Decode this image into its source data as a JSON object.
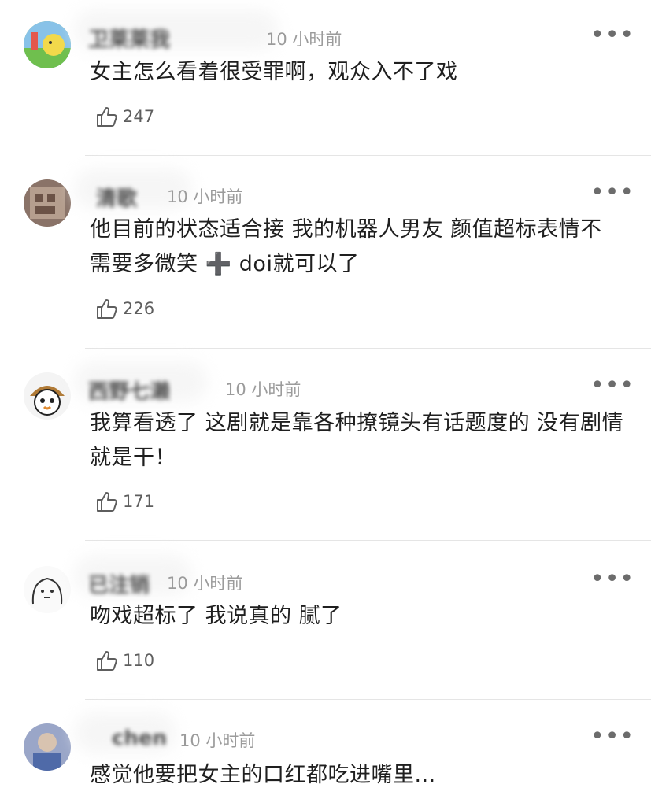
{
  "comments": [
    {
      "username": "卫莱莱我",
      "time": "10 小时前",
      "text": "女主怎么看着很受罪啊，观众入不了戏",
      "likes": "247",
      "more": "•••"
    },
    {
      "username": "清歌",
      "time": "10 小时前",
      "text": "他目前的状态适合接 我的机器人男友 颜值超标表情不需要多微笑 ➕ doi就可以了",
      "likes": "226",
      "more": "•••"
    },
    {
      "username": "西野七濑",
      "time": "10 小时前",
      "text": "我算看透了 这剧就是靠各种撩镜头有话题度的 没有剧情就是干！",
      "likes": "171",
      "more": "•••"
    },
    {
      "username": "已注销",
      "time": "10 小时前",
      "text": "吻戏超标了 我说真的 腻了",
      "likes": "110",
      "more": "•••"
    },
    {
      "username": "chen",
      "time": "10 小时前",
      "text": "感觉他要把女主的口红都吃进嘴里...",
      "likes": "",
      "more": "•••"
    }
  ],
  "colors": {
    "time": "#9b9b9b",
    "divider": "#e5e5e5",
    "like": "#5e5e5e"
  }
}
